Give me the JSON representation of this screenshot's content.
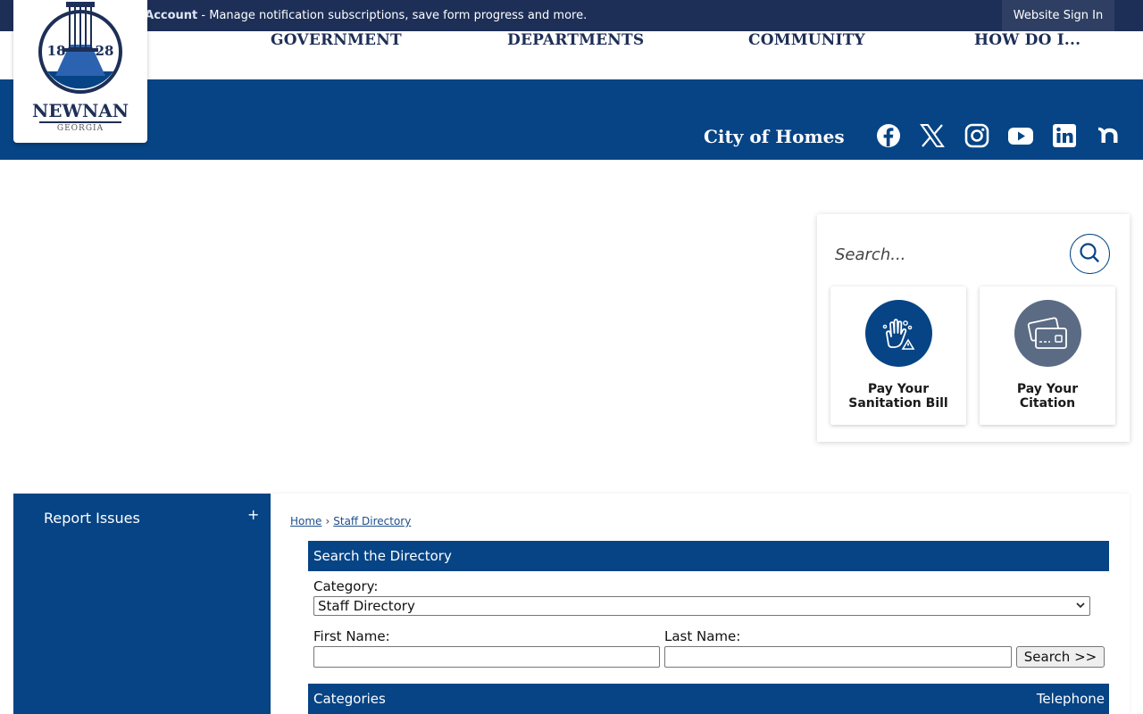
{
  "topbar": {
    "create_account_link": "Create a Website Account",
    "message": " - Manage notification subscriptions, save form progress and more.",
    "signin_label": "Website Sign In"
  },
  "logo": {
    "year_left": "18",
    "year_right": "28",
    "name": "NEWNAN",
    "state": "GEORGIA"
  },
  "nav": {
    "items": [
      "GOVERNMENT",
      "DEPARTMENTS",
      "COMMUNITY",
      "HOW DO I..."
    ]
  },
  "banner": {
    "tagline": "City of Homes",
    "social_icons": [
      "facebook-icon",
      "x-icon",
      "instagram-icon",
      "youtube-icon",
      "linkedin-icon",
      "nextdoor-icon"
    ]
  },
  "search": {
    "placeholder": "Search..."
  },
  "quick_links": [
    {
      "line1": "Pay Your",
      "line2": "Sanitation Bill",
      "icon": "sanitation-hand-icon",
      "color": "#064485"
    },
    {
      "line1": "Pay Your",
      "line2": "Citation",
      "icon": "credit-card-icon",
      "color": "#5b6b84"
    }
  ],
  "sidebar": {
    "item": "Report Issues",
    "expand": "+"
  },
  "breadcrumb": {
    "home": "Home",
    "separator": "›",
    "current": "Staff Directory"
  },
  "directory": {
    "header": "Search the Directory",
    "category_label": "Category:",
    "category_value": "Staff Directory",
    "first_name_label": "First Name:",
    "last_name_label": "Last Name:",
    "search_button": "Search >>",
    "categories_header": "Categories",
    "telephone_header": "Telephone"
  },
  "colors": {
    "navy": "#1d2f57",
    "brand_blue": "#064485",
    "slate": "#5b6b84"
  }
}
